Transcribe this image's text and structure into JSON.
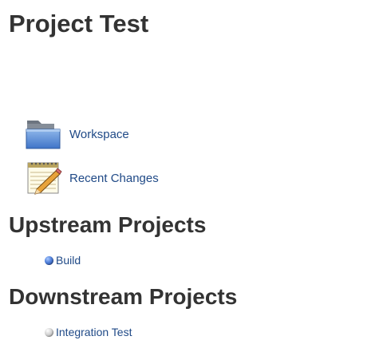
{
  "page": {
    "title": "Project Test"
  },
  "actions": [
    {
      "label": "Workspace",
      "icon": "folder-icon"
    },
    {
      "label": "Recent Changes",
      "icon": "notepad-icon"
    }
  ],
  "upstream": {
    "heading": "Upstream Projects",
    "projects": [
      {
        "label": "Build",
        "status": "blue-ball-icon",
        "color": "#4f7fd9"
      }
    ]
  },
  "downstream": {
    "heading": "Downstream Projects",
    "projects": [
      {
        "label": "Integration Test",
        "status": "grey-ball-icon",
        "color": "#cfcfcf"
      }
    ]
  },
  "colors": {
    "link": "#204a87",
    "heading": "#333333"
  }
}
